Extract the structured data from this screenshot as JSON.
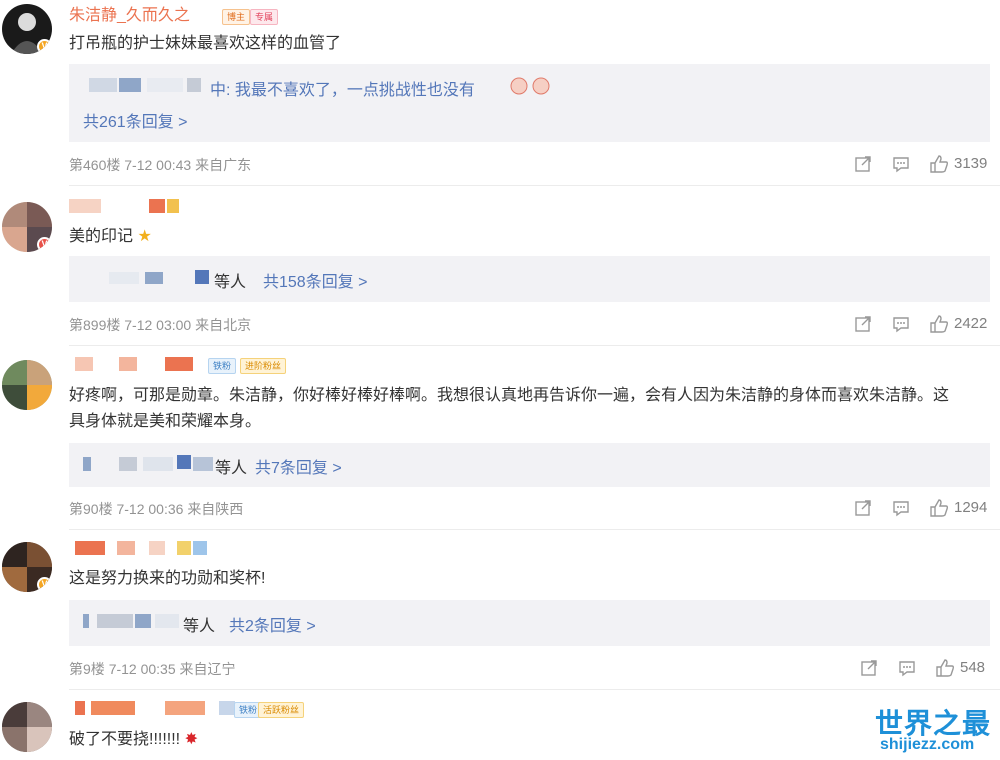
{
  "comments": [
    {
      "username": "朱洁静_久而久之",
      "badges": [
        "博主",
        "专属"
      ],
      "text": "打吊瓶的护士妹妹最喜欢这样的血管了",
      "reply_preview": "中: 我最不喜欢了，一点挑战性也没有",
      "reply_count": "共261条回复 >",
      "floor": "第460楼",
      "time": "7-12 00:43",
      "location": "来自广东",
      "likes": "3139"
    },
    {
      "username": "",
      "text": "美的印记",
      "reply_preview": "等人",
      "reply_count": "共158条回复 >",
      "floor": "第899楼",
      "time": "7-12 03:00",
      "location": "来自北京",
      "likes": "2422"
    },
    {
      "username": "",
      "badges": [
        "铁粉",
        "进阶粉丝"
      ],
      "text": "好疼啊，可那是勋章。朱洁静，你好棒好棒好棒啊。我想很认真地再告诉你一遍，会有人因为朱洁静的身体而喜欢朱洁静。这具身体就是美和荣耀本身。",
      "reply_preview": "等人",
      "reply_count": "共7条回复 >",
      "floor": "第90楼",
      "time": "7-12 00:36",
      "location": "来自陕西",
      "likes": "1294"
    },
    {
      "username": "",
      "text": "这是努力换来的功勋和奖杯!",
      "reply_preview": "等人",
      "reply_count": "共2条回复 >",
      "floor": "第9楼",
      "time": "7-12 00:35",
      "location": "来自辽宁",
      "likes": "548"
    },
    {
      "username": "",
      "badges": [
        "铁粉",
        "活跃粉丝"
      ],
      "text": "破了不要挠!!!!!!!"
    }
  ],
  "watermark": {
    "title": "世界之最",
    "domain": "shijiezz.com"
  },
  "colors": {
    "username": "#eb7350",
    "link": "#5477b9",
    "meta": "#939393",
    "reply_bg": "#f2f2f5"
  },
  "icons": {
    "share": "share-icon",
    "comment": "comment-icon",
    "like": "thumb-up-icon"
  }
}
